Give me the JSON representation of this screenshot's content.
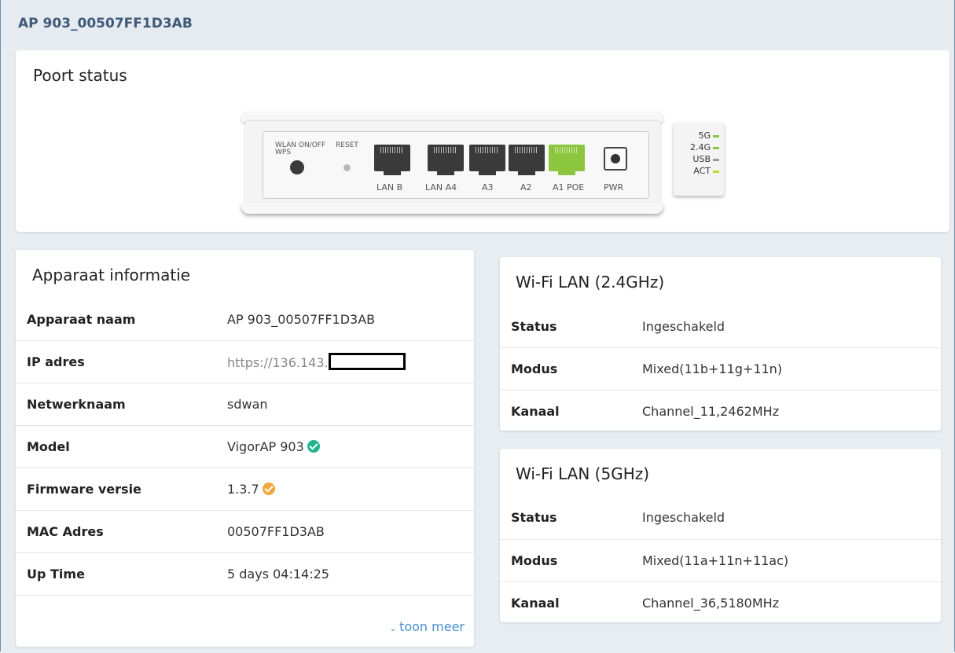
{
  "window": {
    "title": "AP 903_00507FF1D3AB"
  },
  "poort_status": {
    "title": "Poort status",
    "device": {
      "labels": {
        "wlan": "WLAN ON/OFF",
        "wps": "WPS",
        "reset": "RESET",
        "lan_b": "LAN B",
        "lan_a4": "LAN  A4",
        "a3": "A3",
        "a2": "A2",
        "a1_poe": "A1 POE",
        "pwr": "PWR"
      },
      "leds": [
        {
          "label": "5G",
          "color": "#8cc63f"
        },
        {
          "label": "2.4G",
          "color": "#8cc63f"
        },
        {
          "label": "USB",
          "color": "#9a9a9a"
        },
        {
          "label": "ACT",
          "color": "#c8d92a"
        }
      ],
      "poe_color": "#8cc63f"
    }
  },
  "apparaat": {
    "title": "Apparaat informatie",
    "rows": [
      {
        "key": "Apparaat naam",
        "value": "AP 903_00507FF1D3AB"
      },
      {
        "key": "IP adres",
        "value": "https://136.143."
      },
      {
        "key": "Netwerknaam",
        "value": "sdwan"
      },
      {
        "key": "Model",
        "value": "VigorAP 903"
      },
      {
        "key": "Firmware versie",
        "value": "1.3.7"
      },
      {
        "key": "MAC Adres",
        "value": "00507FF1D3AB"
      },
      {
        "key": "Up Time",
        "value": "5 days 04:14:25"
      }
    ],
    "model_badge_color": "#1fb58f",
    "firmware_badge_color": "#f0a83c",
    "toon_meer": "toon meer"
  },
  "wifi24": {
    "title": "Wi-Fi LAN (2.4GHz)",
    "rows": [
      {
        "key": "Status",
        "value": "Ingeschakeld"
      },
      {
        "key": "Modus",
        "value": "Mixed(11b+11g+11n)"
      },
      {
        "key": "Kanaal",
        "value": "Channel_11,2462MHz"
      }
    ]
  },
  "wifi5": {
    "title": "Wi-Fi LAN (5GHz)",
    "rows": [
      {
        "key": "Status",
        "value": "Ingeschakeld"
      },
      {
        "key": "Modus",
        "value": "Mixed(11a+11n+11ac)"
      },
      {
        "key": "Kanaal",
        "value": "Channel_36,5180MHz"
      }
    ]
  }
}
